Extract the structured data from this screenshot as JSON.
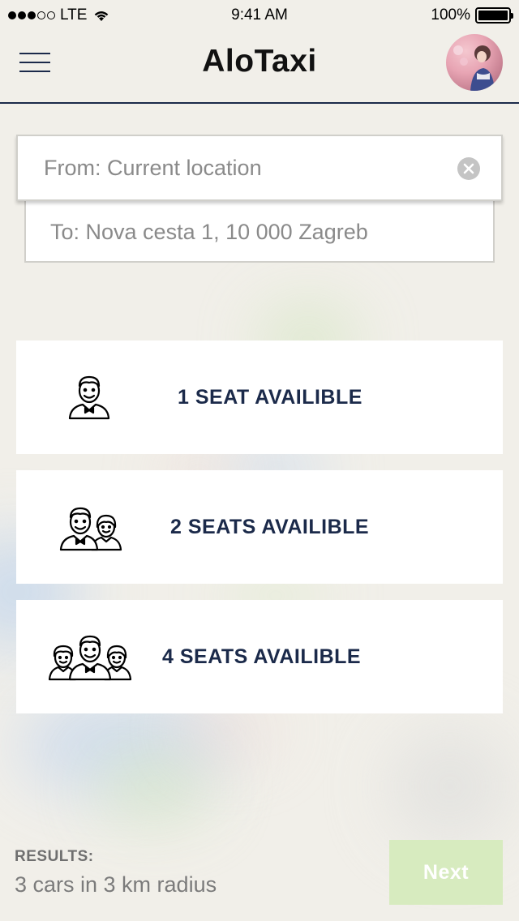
{
  "status_bar": {
    "carrier": "LTE",
    "time": "9:41 AM",
    "battery": "100%",
    "signal_bars": 3,
    "signal_total": 5
  },
  "header": {
    "title": "AloTaxi",
    "menu_icon": "hamburger-menu-icon",
    "avatar_icon": "user-avatar"
  },
  "route": {
    "from_value": "From: Current location",
    "to_value": "To: Nova cesta 1, 10 000 Zagreb",
    "clear_icon": "clear-icon"
  },
  "seat_options": [
    {
      "label": "1 SEAT AVAILIBLE",
      "icon": "one-person-icon"
    },
    {
      "label": "2 SEATS AVAILIBLE",
      "icon": "two-persons-icon"
    },
    {
      "label": "4 SEATS AVAILIBLE",
      "icon": "group-persons-icon"
    }
  ],
  "footer": {
    "results_title": "RESULTS:",
    "results_text": "3 cars in 3 km radius",
    "next_label": "Next"
  },
  "colors": {
    "primary": "#1b2a4a",
    "next_button": "#d7ebbf",
    "background": "#efede6"
  }
}
